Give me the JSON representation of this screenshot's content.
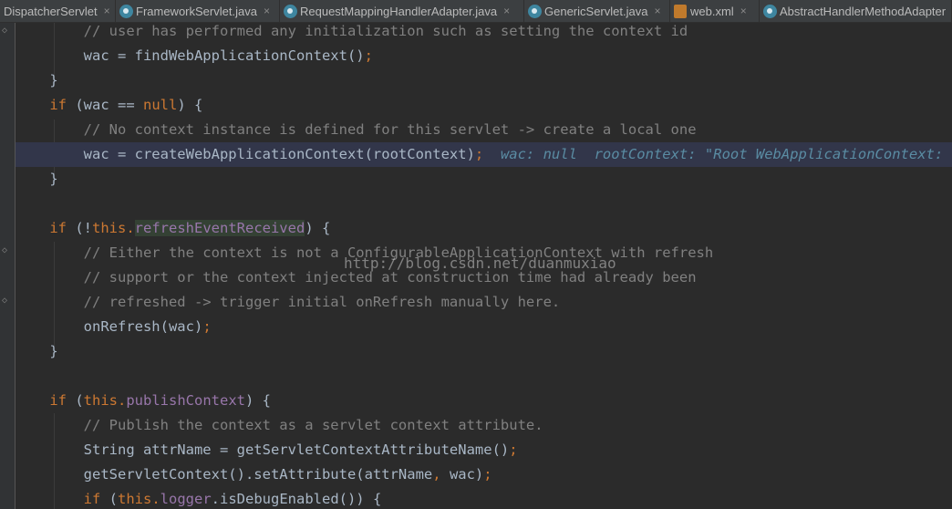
{
  "tabs": [
    {
      "label": "DispatcherServlet",
      "icon": "none",
      "close": "×"
    },
    {
      "label": "FrameworkServlet.java",
      "icon": "java-class-icon",
      "close": "×"
    },
    {
      "label": "RequestMappingHandlerAdapter.java",
      "icon": "java-class-icon",
      "close": "×"
    },
    {
      "label": "GenericServlet.java",
      "icon": "java-class-icon",
      "close": "×"
    },
    {
      "label": "web.xml",
      "icon": "xml-file-icon",
      "close": "×"
    },
    {
      "label": "AbstractHandlerMethodAdapter",
      "icon": "java-class-icon",
      "close": ""
    }
  ],
  "code": {
    "l1_comment": "// user has performed any initialization such as setting the context id",
    "l2_text": "wac = findWebApplicationContext()",
    "l3_text": "}",
    "l4_kw": "if",
    "l4_a": " (wac == ",
    "l4_null": "null",
    "l4_b": ") {",
    "l5_comment": "// No context instance is defined for this servlet -> create a local one",
    "l6_text": "wac = createWebApplicationContext(rootContext)",
    "l6_inline": "wac: null  rootContext: \"Root WebApplicationContext: startup date",
    "l7_text": "}",
    "l9_kw": "if",
    "l9_a": " (!",
    "l9_this": "this",
    "l9_field": "refreshEventReceived",
    "l9_b": ") {",
    "l10_comment": "// Either the context is not a ConfigurableApplicationContext with refresh",
    "l11_comment": "// support or the context injected at construction time had already been",
    "l12_comment": "// refreshed -> trigger initial onRefresh manually here.",
    "l13_text": "onRefresh(wac)",
    "l14_text": "}",
    "l16_kw": "if",
    "l16_this": "this",
    "l16_field": "publishContext",
    "l16_b": ") {",
    "l17_comment": "// Publish the context as a servlet context attribute.",
    "l18_text": "String attrName = getServletContextAttributeName()",
    "l19_text": "getServletContext().setAttribute(attrName",
    "l19_b": " wac)",
    "l20_kw": "if",
    "l20_this": "this",
    "l20_field": "logger",
    "l20_b": ".isDebugEnabled()) {",
    "semicolon": ";",
    "comma": ",",
    "dot": ".",
    "paren_open": " (",
    "indent1": "    ",
    "indent2": "        "
  },
  "watermark": "http://blog.csdn.net/duanmuxiao",
  "colors": {
    "background": "#2b2b2b",
    "keyword": "#cc7832",
    "comment": "#808080",
    "field": "#9876aa",
    "text": "#a9b7c6",
    "current_line": "#32364a",
    "inline_value": "#5a8ca3"
  }
}
